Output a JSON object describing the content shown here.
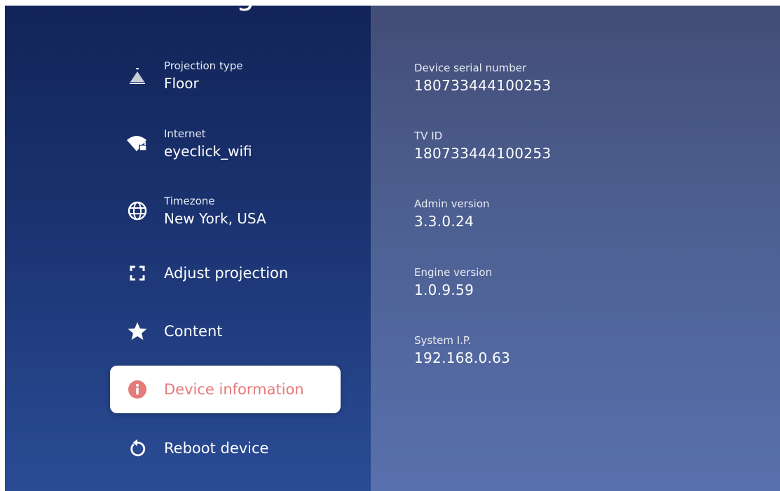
{
  "page_title": "Settings",
  "menu": {
    "projection_type": {
      "caption": "Projection type",
      "value": "Floor",
      "icon": "projection-icon"
    },
    "internet": {
      "caption": "Internet",
      "value": "eyeclick_wifi",
      "icon": "wifi-lock-icon"
    },
    "timezone": {
      "caption": "Timezone",
      "value": "New York, USA",
      "icon": "globe-icon"
    },
    "adjust_projection": {
      "label": "Adjust projection",
      "icon": "frame-corners-icon"
    },
    "content": {
      "label": "Content",
      "icon": "star-icon"
    },
    "device_information": {
      "label": "Device information",
      "icon": "info-icon"
    },
    "reboot_device": {
      "label": "Reboot device",
      "icon": "reboot-icon"
    }
  },
  "device_info": {
    "serial": {
      "label": "Device serial number",
      "value": "180733444100253"
    },
    "tv_id": {
      "label": "TV ID",
      "value": "180733444100253"
    },
    "admin_version": {
      "label": "Admin version",
      "value": "3.3.0.24"
    },
    "engine_version": {
      "label": "Engine version",
      "value": "1.0.9.59"
    },
    "system_ip": {
      "label": "System I.P.",
      "value": "192.168.0.63"
    }
  },
  "colors": {
    "left_panel_top": "#122458",
    "left_panel_bottom": "#2a4c95",
    "right_panel_top": "#434d76",
    "right_panel_bottom": "#5870ad",
    "selected_accent": "#e57a7a"
  }
}
